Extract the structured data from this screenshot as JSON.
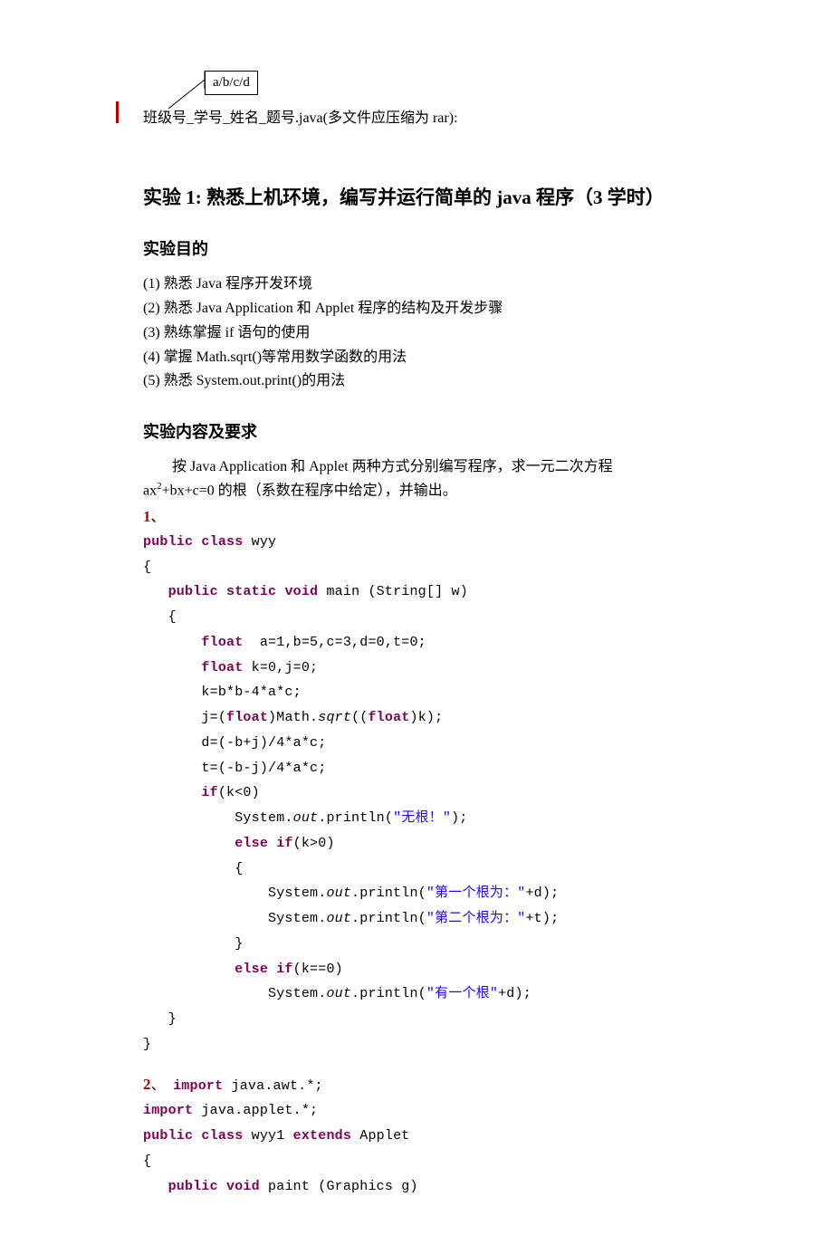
{
  "callout": "a/b/c/d",
  "header": "班级号_学号_姓名_题号.java(多文件应压缩为 rar):",
  "title": "实验 1: 熟悉上机环境，编写并运行简单的 java 程序（3 学时）",
  "section1_title": "实验目的",
  "objectives": [
    "(1) 熟悉 Java 程序开发环境",
    "(2) 熟悉 Java Application 和 Applet 程序的结构及开发步骤",
    "(3) 熟练掌握 if 语句的使用",
    "(4) 掌握 Math.sqrt()等常用数学函数的用法",
    "(5) 熟悉 System.out.print()的用法"
  ],
  "section2_title": "实验内容及要求",
  "desc_line1_a": "按 Java Application 和 Applet 两种方式分别编写程序，求一元二次方程",
  "desc_line2_a": "ax",
  "desc_line2_sup": "2",
  "desc_line2_b": "+bx+c=0 的根（系数在程序中给定），并输出。",
  "code1_num": "1",
  "code1_punct": "、",
  "code2_num": "2",
  "code2_punct": "、",
  "code1": {
    "l1a": "public",
    "l1b": " ",
    "l1c": "class",
    "l1d": " wyy",
    "l2": "{",
    "l3a": "public",
    "l3b": " ",
    "l3c": "static",
    "l3d": " ",
    "l3e": "void",
    "l3f": " main (String[] w)",
    "l4": "{",
    "l5a": "float",
    "l5b": "  a=1,b=5,c=3,d=0,t=0;",
    "l6a": "float",
    "l6b": " k=0,j=0;",
    "l7": "k=b*b-4*a*c;",
    "l8a": "j=(",
    "l8b": "float",
    "l8c": ")Math.",
    "l8d": "sqrt",
    "l8e": "((",
    "l8f": "float",
    "l8g": ")k);",
    "l9": "d=(-b+j)/4*a*c;",
    "l10": "t=(-b-j)/4*a*c;",
    "l11a": "if",
    "l11b": "(k<0)",
    "l12a": "System.",
    "l12b": "out",
    "l12c": ".println(",
    "l12d": "\"无根！\"",
    "l12e": ");",
    "l13a": "else",
    "l13b": " ",
    "l13c": "if",
    "l13d": "(k>0)",
    "l14": "{",
    "l15a": "System.",
    "l15b": "out",
    "l15c": ".println(",
    "l15d": "\"第一个根为：\"",
    "l15e": "+d);",
    "l16a": "System.",
    "l16b": "out",
    "l16c": ".println(",
    "l16d": "\"第二个根为：\"",
    "l16e": "+t);",
    "l17": "}",
    "l18a": "else",
    "l18b": " ",
    "l18c": "if",
    "l18d": "(k==0)",
    "l19a": "System.",
    "l19b": "out",
    "l19c": ".println(",
    "l19d": "\"有一个根\"",
    "l19e": "+d);",
    "l20": "}",
    "l21": "}"
  },
  "code2": {
    "l1a": "import",
    "l1b": " java.awt.*;",
    "l2a": "import",
    "l2b": " java.applet.*;",
    "l3a": "public",
    "l3b": " ",
    "l3c": "class",
    "l3d": " wyy1 ",
    "l3e": "extends",
    "l3f": " Applet",
    "l4": "{",
    "l5a": "public",
    "l5b": " ",
    "l5c": "void",
    "l5d": " paint (Graphics g)"
  }
}
